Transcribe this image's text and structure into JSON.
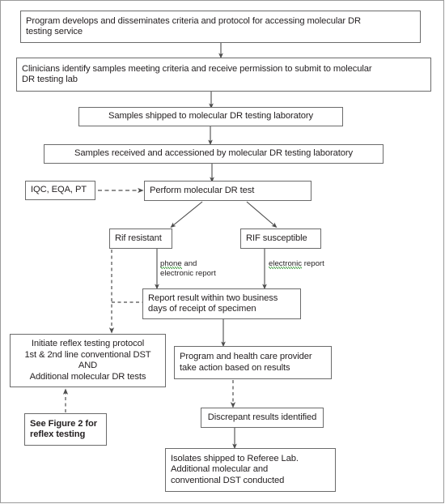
{
  "figure": {
    "title": "Molecular DR testing service flowchart",
    "line_color": "#4d4d4d",
    "box_border_color": "#6b6b6b",
    "text_color": "#231f20",
    "spellcheck_color": "#4aa14a",
    "background": "#ffffff"
  },
  "nodes": {
    "program_criteria": {
      "lines": [
        "Program develops and disseminates criteria and protocol for accessing molecular DR",
        "testing service"
      ]
    },
    "clinicians_identify": {
      "lines": [
        "Clinicians identify samples meeting criteria and receive permission to submit to molecular",
        "DR testing lab"
      ]
    },
    "samples_shipped": {
      "lines": [
        "Samples shipped to molecular DR testing laboratory"
      ]
    },
    "samples_received": {
      "lines": [
        "Samples received and accessioned by molecular DR testing laboratory"
      ]
    },
    "iqc_eqa_pt": {
      "lines": [
        "IQC, EQA, PT"
      ]
    },
    "perform_test": {
      "lines": [
        "Perform molecular DR test"
      ]
    },
    "rif_resistant": {
      "lines": [
        "Rif resistant"
      ]
    },
    "rif_susceptible": {
      "lines": [
        "RIF susceptible"
      ]
    },
    "report_result": {
      "lines": [
        "Report result within two business",
        "days of receipt of specimen"
      ]
    },
    "initiate_reflex": {
      "lines": [
        "Initiate reflex testing protocol",
        "1st & 2nd line conventional DST",
        "AND",
        "Additional molecular DR tests"
      ]
    },
    "see_figure_2": {
      "lines": [
        "See Figure 2 for",
        "reflex testing"
      ]
    },
    "program_action": {
      "lines": [
        "Program and health care provider",
        "take action based on results"
      ]
    },
    "discrepant_results": {
      "lines": [
        "Discrepant results identified"
      ]
    },
    "isolates_shipped": {
      "lines": [
        "Isolates shipped to Referee Lab.",
        "Additional molecular and",
        "conventional DST conducted"
      ]
    }
  },
  "edge_labels": {
    "phone_report": {
      "line1_spell": "phone",
      "line1_rest": " and",
      "line2": "electronic report"
    },
    "electronic_report": {
      "spell": "electronic",
      "rest": " report"
    }
  }
}
